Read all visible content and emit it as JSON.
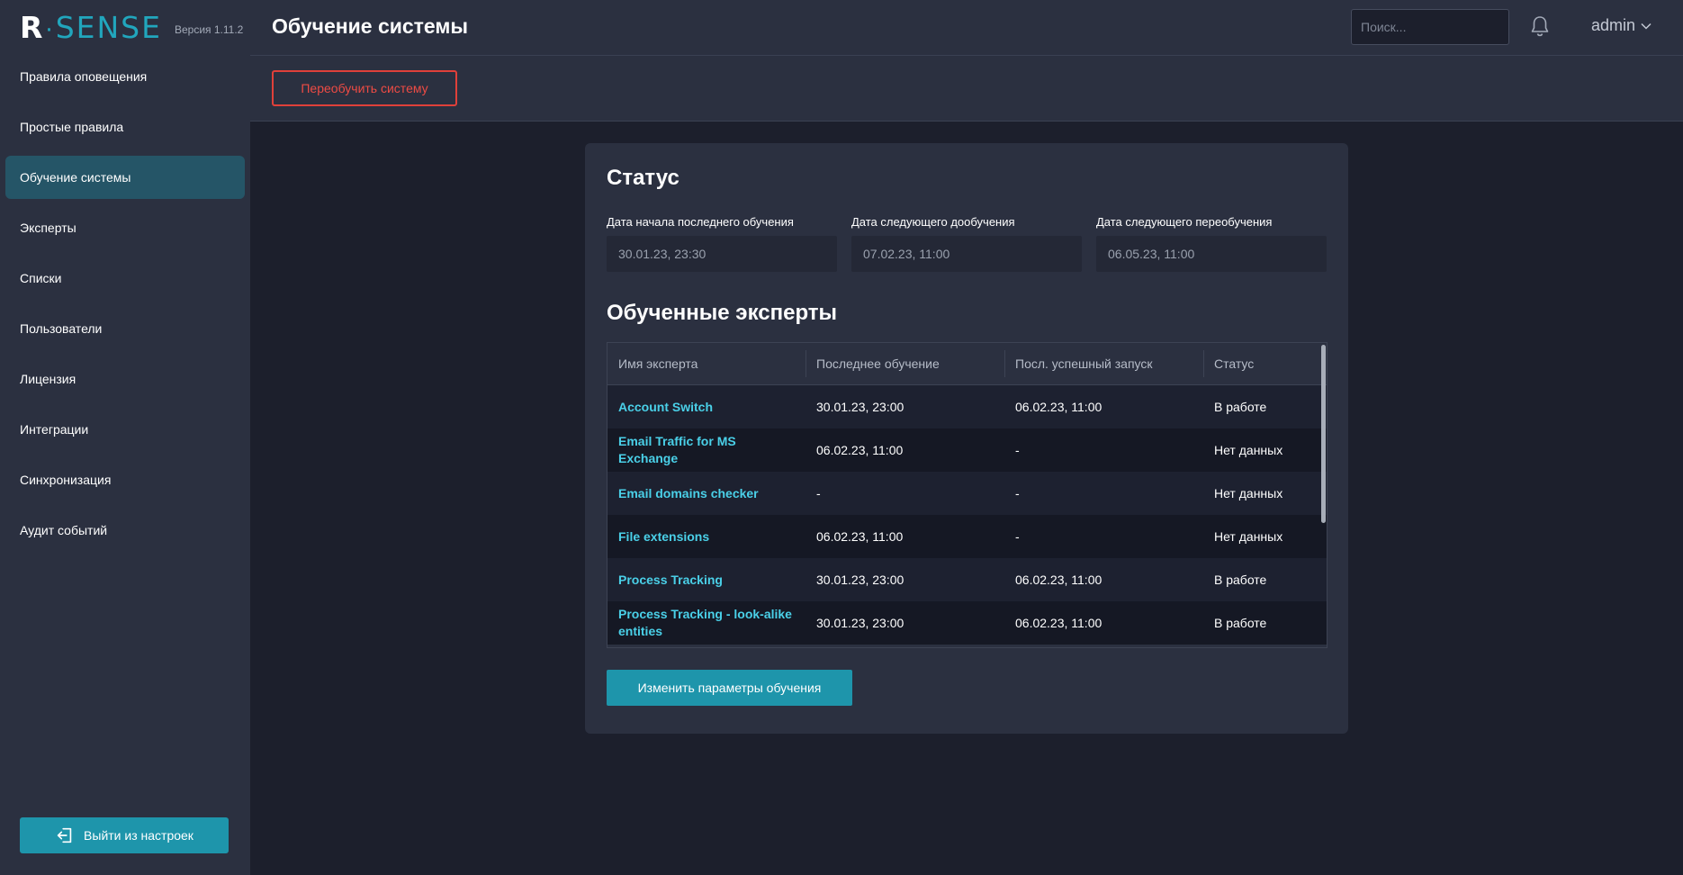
{
  "app": {
    "logo_r": "R",
    "logo_dot": "·",
    "logo_rest": "SENSE",
    "version": "Версия 1.11.2"
  },
  "sidebar": {
    "items": [
      {
        "label": "Правила оповещения"
      },
      {
        "label": "Простые правила"
      },
      {
        "label": "Обучение системы",
        "active": true
      },
      {
        "label": "Эксперты"
      },
      {
        "label": "Списки"
      },
      {
        "label": "Пользователи"
      },
      {
        "label": "Лицензия"
      },
      {
        "label": "Интеграции"
      },
      {
        "label": "Синхронизация"
      },
      {
        "label": "Аудит событий"
      }
    ],
    "logout_label": "Выйти из настроек"
  },
  "header": {
    "title": "Обучение системы",
    "search_placeholder": "Поиск...",
    "user": "admin"
  },
  "toolbar": {
    "retrain_label": "Переобучить систему"
  },
  "status": {
    "title": "Статус",
    "fields": [
      {
        "label": "Дата начала последнего обучения",
        "value": "30.01.23, 23:30"
      },
      {
        "label": "Дата следующего дообучения",
        "value": "07.02.23, 11:00"
      },
      {
        "label": "Дата следующего переобучения",
        "value": "06.05.23, 11:00"
      }
    ]
  },
  "experts": {
    "title": "Обученные эксперты",
    "columns": [
      "Имя эксперта",
      "Последнее обучение",
      "Посл. успешный запуск",
      "Статус"
    ],
    "rows": [
      {
        "name": "Account Switch",
        "last": "30.01.23, 23:00",
        "run": "06.02.23, 11:00",
        "status": "В работе"
      },
      {
        "name": "Email Traffic for MS Exchange",
        "last": "06.02.23, 11:00",
        "run": "-",
        "status": "Нет данных"
      },
      {
        "name": "Email domains checker",
        "last": "-",
        "run": "-",
        "status": "Нет данных"
      },
      {
        "name": "File extensions",
        "last": "06.02.23, 11:00",
        "run": "-",
        "status": "Нет данных"
      },
      {
        "name": "Process Tracking",
        "last": "30.01.23, 23:00",
        "run": "06.02.23, 11:00",
        "status": "В работе"
      },
      {
        "name": "Process Tracking - look-alike entities",
        "last": "30.01.23, 23:00",
        "run": "06.02.23, 11:00",
        "status": "В работе"
      }
    ],
    "change_params_label": "Изменить параметры обучения"
  },
  "colors": {
    "accent": "#1e95ab",
    "danger": "#e0403a",
    "link": "#4ad0e8",
    "panel": "#2b3040",
    "background": "#1c1f2c"
  }
}
